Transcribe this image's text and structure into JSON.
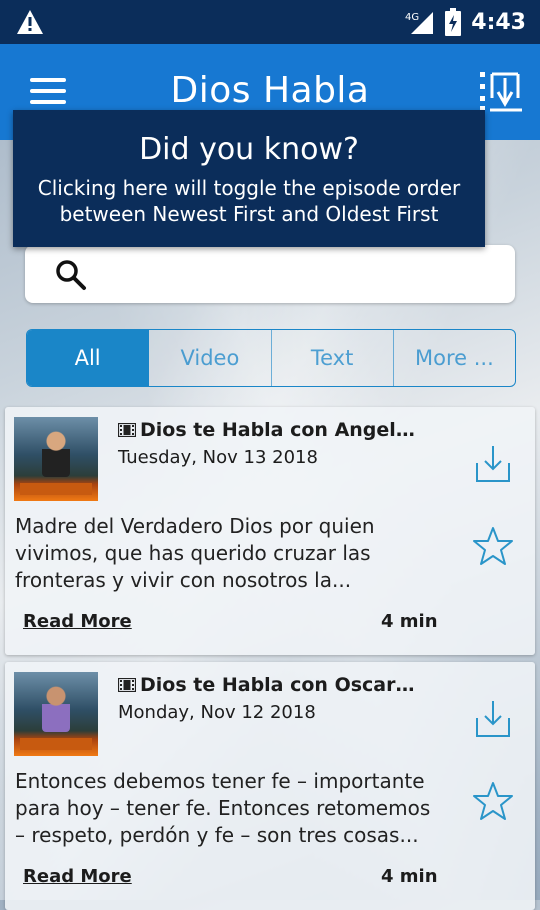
{
  "status_bar": {
    "network": "4G",
    "time": "4:43"
  },
  "app_bar": {
    "title": "Dios Habla"
  },
  "tooltip": {
    "title": "Did you know?",
    "body": "Clicking here will toggle the episode order between Newest First and Oldest First"
  },
  "search": {
    "placeholder": "",
    "value": ""
  },
  "tabs": [
    {
      "label": "All",
      "active": true
    },
    {
      "label": "Video",
      "active": false
    },
    {
      "label": "Text",
      "active": false
    },
    {
      "label": "More ...",
      "active": false
    }
  ],
  "episodes": [
    {
      "title": "Dios te Habla con Angela...",
      "date": "Tuesday, Nov 13 2018",
      "description": "Madre del Verdadero Dios por quien vivimos, que has querido cruzar las fronteras y vivir con nosotros la...",
      "read_more": "Read More",
      "duration": "4 min"
    },
    {
      "title": "Dios te Habla con Oscar Arl...",
      "date": "Monday, Nov 12 2018",
      "description": " Entonces debemos tener fe – importante para hoy – tener fe. Entonces retomemos – respeto, perdón y fe – son tres cosas...",
      "read_more": "Read More",
      "duration": "4 min"
    }
  ],
  "colors": {
    "status_bar": "#0b2d5a",
    "app_bar": "#1778d2",
    "tooltip": "#0b2d5a",
    "accent": "#1a86c8"
  }
}
